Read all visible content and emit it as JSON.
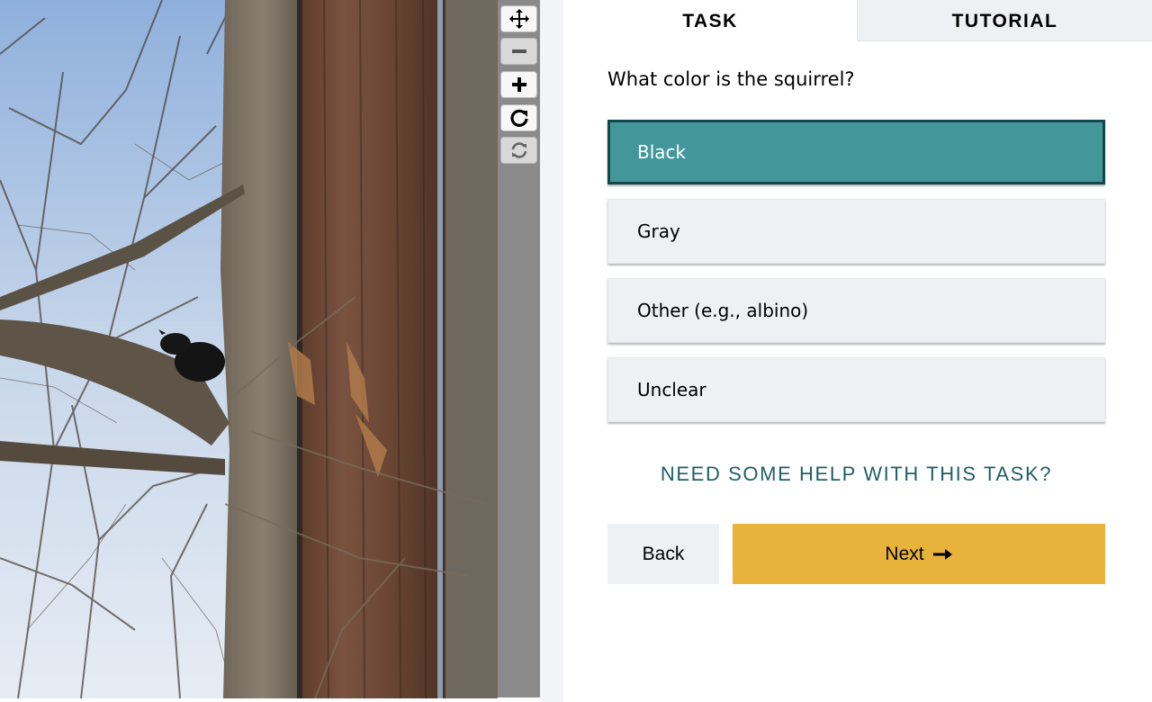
{
  "tabs": {
    "task": "TASK",
    "tutorial": "TUTORIAL"
  },
  "question": "What color is the squirrel?",
  "answers": [
    {
      "label": "Black",
      "selected": true
    },
    {
      "label": "Gray",
      "selected": false
    },
    {
      "label": "Other (e.g., albino)",
      "selected": false
    },
    {
      "label": "Unclear",
      "selected": false
    }
  ],
  "help_link": "NEED SOME HELP WITH THIS TASK?",
  "buttons": {
    "back": "Back",
    "next": "Next",
    "next_icon": "arrow-right-icon"
  },
  "toolbar": {
    "tools": [
      "move-icon",
      "zoom-out-icon",
      "zoom-in-icon",
      "rotate-icon",
      "reset-icon"
    ]
  },
  "subject_image": {
    "description_icon": "squirrel-on-branch-photo"
  },
  "colors": {
    "selected_answer": "#43979b",
    "selected_border": "#14474c",
    "answer_bg": "#eef1f4",
    "next_button": "#e8b33a",
    "help_link": "#1f5f67",
    "toolbar_bg": "#8a8a8a"
  }
}
